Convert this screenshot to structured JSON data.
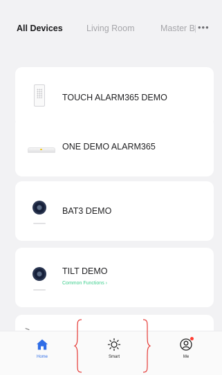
{
  "tabs": {
    "items": [
      {
        "label": "All Devices",
        "active": true
      },
      {
        "label": "Living Room",
        "active": false
      },
      {
        "label": "Master Bedroom",
        "active": false
      }
    ],
    "more_icon": "more-dots-icon"
  },
  "devices": [
    {
      "name": "TOUCH ALARM365 DEMO",
      "icon": "touch-panel-icon"
    },
    {
      "name": "ONE DEMO ALARM365",
      "icon": "base-station-icon"
    },
    {
      "name": "BAT3 DEMO",
      "icon": "camera-icon"
    },
    {
      "name": "TILT DEMO",
      "icon": "camera-icon",
      "subtitle": "Common Functions ›"
    }
  ],
  "bottom_nav": {
    "items": [
      {
        "label": "Home",
        "icon": "home-icon",
        "active": true
      },
      {
        "label": "Smart",
        "icon": "sun-icon",
        "active": false
      },
      {
        "label": "Me",
        "icon": "user-icon",
        "active": false,
        "badge": true
      }
    ]
  },
  "colors": {
    "accent": "#2f6de6",
    "subtitle_green": "#3ecf8e",
    "annotation_red": "#e53935",
    "badge_red": "#ff3b30"
  }
}
